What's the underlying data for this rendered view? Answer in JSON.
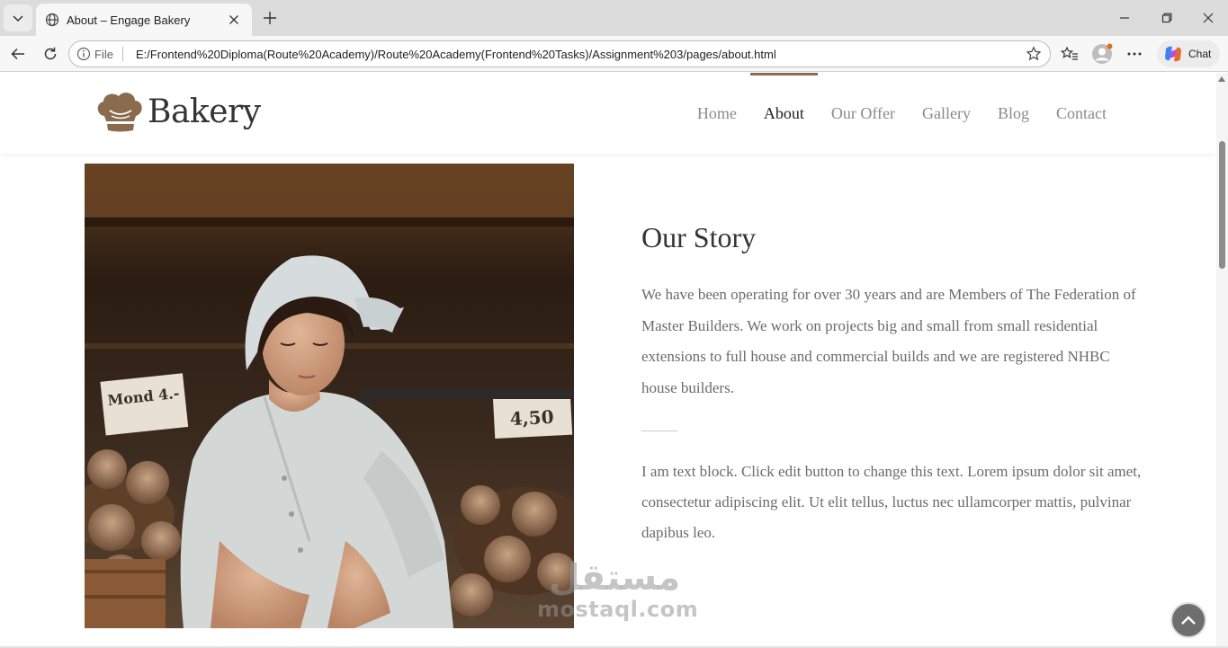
{
  "browser": {
    "tab_title": "About – Engage Bakery",
    "address_chip": "File",
    "url": "E:/Frontend%20Diploma(Route%20Academy)/Route%20Academy(Frontend%20Tasks)/Assignment%203/pages/about.html",
    "chat_label": "Chat",
    "icons": [
      "tab-list-icon",
      "globe-icon",
      "close-icon",
      "plus-icon",
      "minimize-icon",
      "restore-icon",
      "window-close-icon",
      "back-icon",
      "refresh-icon",
      "info-icon",
      "star-icon",
      "favorites-icon",
      "profile-icon",
      "more-icon",
      "copilot-icon"
    ]
  },
  "site": {
    "logo_text": "Bakery",
    "nav": {
      "home": "Home",
      "about": "About",
      "offer": "Our Offer",
      "gallery": "Gallery",
      "blog": "Blog",
      "contact": "Contact"
    },
    "active_nav": "About",
    "accent_color": "#8b6b4e"
  },
  "story": {
    "title": "Our Story",
    "paragraph1": "We have been operating for over 30 years and are Members of The Federation of Master Builders. We work on projects big and small from small residential extensions to full house and commercial builds and we are registered NHBC house builders.",
    "paragraph2": "I am text block. Click edit button to change this text. Lorem ipsum dolor sit amet, consectetur adipiscing elit. Ut elit tellus, luctus nec ullamcorper mattis, pulvinar dapibus leo."
  },
  "photo": {
    "sign_left": "Mond 4.-",
    "sign_right": "4,50"
  },
  "watermark": {
    "arabic": "مستقل",
    "latin": "mostaql.com"
  }
}
